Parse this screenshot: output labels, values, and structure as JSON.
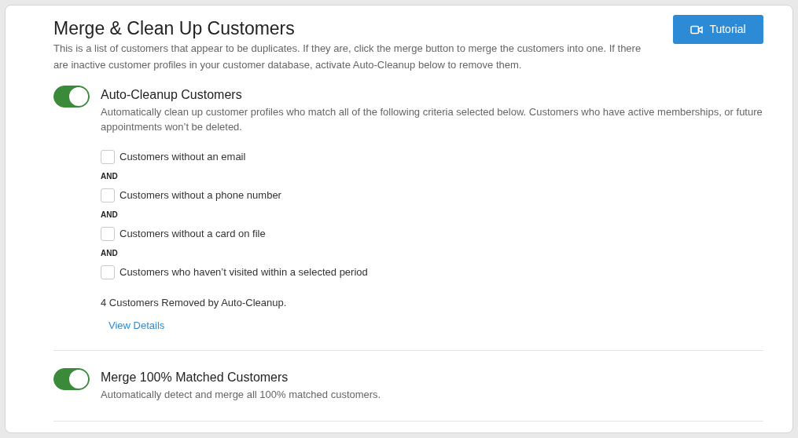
{
  "header": {
    "title": "Merge & Clean Up Customers",
    "description": "This is a list of customers that appear to be duplicates. If they are, click the merge button to merge the customers into one. If there are inactive customer profiles in your customer database, activate Auto-Cleanup below to remove them.",
    "tutorial_button": "Tutorial"
  },
  "sections": [
    {
      "title": "Auto-Cleanup Customers",
      "on": true,
      "description": "Automatically clean up customer profiles who match all of the following criteria selected below. Customers who have active memberships, or future appointments won’t be deleted.",
      "criteria": [
        {
          "kind": "checkbox",
          "label": "Customers without an email",
          "checked": false
        },
        {
          "kind": "separator",
          "label": "AND"
        },
        {
          "kind": "checkbox",
          "label": "Customers without a phone number",
          "checked": false
        },
        {
          "kind": "separator",
          "label": "AND"
        },
        {
          "kind": "checkbox",
          "label": "Customers without a card on file",
          "checked": false
        },
        {
          "kind": "separator",
          "label": "AND"
        },
        {
          "kind": "checkbox",
          "label": "Customers who haven’t visited within a selected period",
          "checked": false
        }
      ],
      "summary": "4 Customers Removed by Auto-Cleanup.",
      "link": "View Details"
    },
    {
      "title": "Merge 100% Matched Customers",
      "on": true,
      "description": "Automatically detect and merge all 100% matched customers."
    }
  ]
}
